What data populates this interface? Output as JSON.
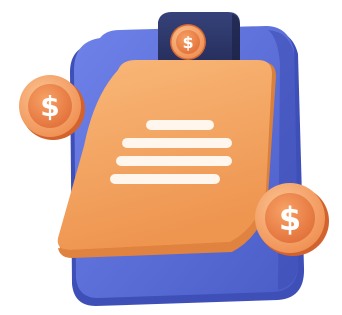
{
  "illustration": {
    "clipboard_icon": "clipboard-icon",
    "document_icon": "document-icon",
    "coin_icon": "dollar-coin-icon",
    "coin_symbol": "$",
    "text_line_count": 4
  },
  "colors": {
    "board_blue": "#5a6fd8",
    "board_blue_dark": "#3f4fb8",
    "clip_navy": "#2b3566",
    "paper_orange": "#f5a35c",
    "paper_orange_dark": "#e88e45",
    "coin_orange": "#f0874a",
    "coin_rim": "#f7b07a",
    "line_white": "#fff6ee"
  }
}
